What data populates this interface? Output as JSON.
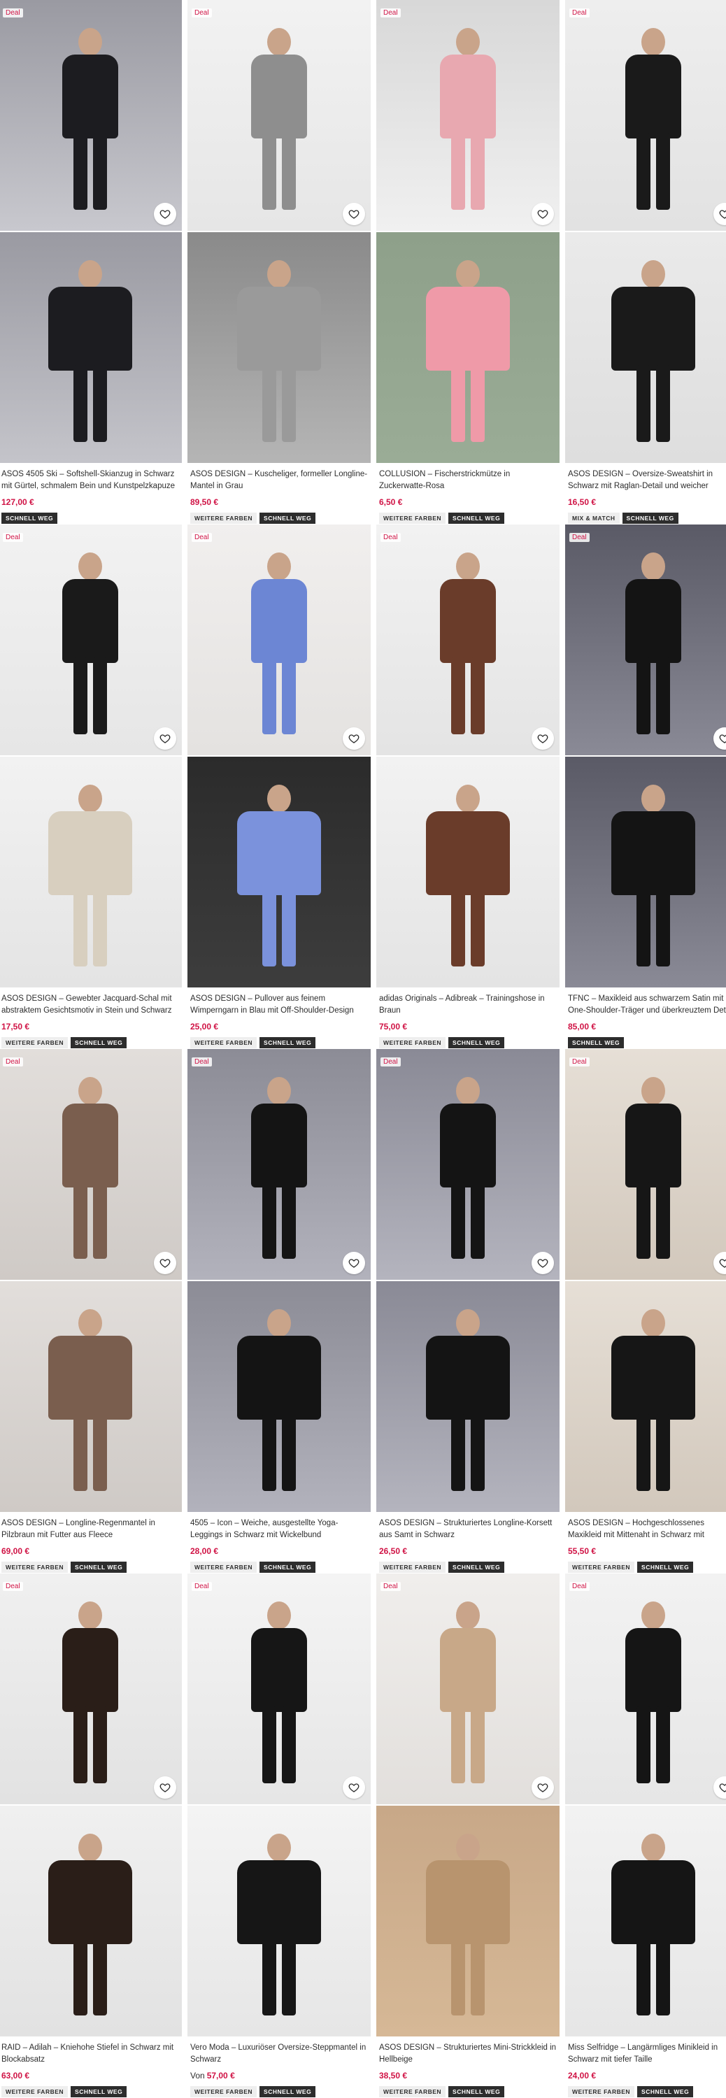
{
  "labels": {
    "deal": "Deal",
    "more_colors": "WEITERE FARBEN",
    "mix_match": "MIX & MATCH",
    "quick_view": "SCHNELL WEG",
    "from": "Von"
  },
  "products": [
    {
      "title": "ASOS 4505 Ski – Softshell-Skianzug in Schwarz mit Gürtel, schmalem Bein und Kunstpelzkapuze",
      "price": "127,00 €",
      "deal": true,
      "badges": [
        "quick_view"
      ]
    },
    {
      "title": "ASOS DESIGN – Kuscheliger, formeller Longline-Mantel in Grau",
      "price": "89,50 €",
      "deal": true,
      "badges": [
        "more_colors",
        "quick_view"
      ]
    },
    {
      "title": "COLLUSION – Fischerstrickmütze in Zuckerwatte-Rosa",
      "price": "6,50 €",
      "deal": true,
      "badges": [
        "more_colors",
        "quick_view"
      ]
    },
    {
      "title": "ASOS DESIGN – Oversize-Sweatshirt in Schwarz mit Raglan-Detail und weicher Innenseite",
      "price": "16,50 €",
      "deal": true,
      "badges": [
        "mix_match",
        "quick_view"
      ]
    },
    {
      "title": "ASOS DESIGN – Gewebter Jacquard-Schal mit abstraktem Gesichtsmotiv in Stein und Schwarz",
      "price": "17,50 €",
      "deal": true,
      "badges": [
        "more_colors",
        "quick_view"
      ]
    },
    {
      "title": "ASOS DESIGN – Pullover aus feinem Wimperngarn in Blau mit Off-Shoulder-Design",
      "price": "25,00 €",
      "deal": true,
      "badges": [
        "more_colors",
        "quick_view"
      ]
    },
    {
      "title": "adidas Originals – Adibreak – Trainingshose in Braun",
      "price": "75,00 €",
      "deal": true,
      "badges": [
        "more_colors",
        "quick_view"
      ]
    },
    {
      "title": "TFNC – Maxikleid aus schwarzem Satin mit One-Shoulder-Träger und überkreuztem Detail am Rücken",
      "price": "85,00 €",
      "deal": true,
      "badges": [
        "quick_view"
      ]
    },
    {
      "title": "ASOS DESIGN – Longline-Regenmantel in Pilzbraun mit Futter aus Fleece",
      "price": "69,00 €",
      "deal": true,
      "badges": [
        "more_colors",
        "quick_view"
      ]
    },
    {
      "title": "4505 – Icon – Weiche, ausgestellte Yoga-Leggings in Schwarz mit Wickelbund",
      "price": "28,00 €",
      "deal": true,
      "badges": [
        "more_colors",
        "quick_view"
      ]
    },
    {
      "title": "ASOS DESIGN – Strukturiertes Longline-Korsett aus Samt in Schwarz",
      "price": "26,50 €",
      "deal": true,
      "badges": [
        "more_colors",
        "quick_view"
      ]
    },
    {
      "title": "ASOS DESIGN – Hochgeschlossenes Maxikleid mit Mittenaht in Schwarz mit Rüschen, Spitzeneinsätzen",
      "price": "55,50 €",
      "deal": true,
      "badges": [
        "more_colors",
        "quick_view"
      ]
    },
    {
      "title": "RAID – Adilah – Kniehohe Stiefel in Schwarz mit Blockabsatz",
      "price": "63,00 €",
      "deal": true,
      "badges": [
        "more_colors",
        "quick_view"
      ]
    },
    {
      "title": "Vero Moda – Luxuriöser Oversize-Steppmantel in Schwarz",
      "price": "57,00 €",
      "from": true,
      "deal": true,
      "badges": [
        "more_colors",
        "quick_view"
      ]
    },
    {
      "title": "ASOS DESIGN – Strukturiertes Mini-Strickkleid in Hellbeige",
      "price": "38,50 €",
      "deal": true,
      "badges": [
        "more_colors",
        "quick_view"
      ]
    },
    {
      "title": "Miss Selfridge – Langärmliges Minikleid in Schwarz mit tiefer Taille",
      "price": "24,00 €",
      "deal": true,
      "badges": [
        "more_colors",
        "quick_view"
      ]
    }
  ],
  "colors": {
    "price": "#d01345",
    "deal": "#d01345",
    "badge_dark": "#2d2d2d",
    "badge_light": "#eeeeee"
  },
  "icons": {
    "favorite": "heart-icon"
  }
}
